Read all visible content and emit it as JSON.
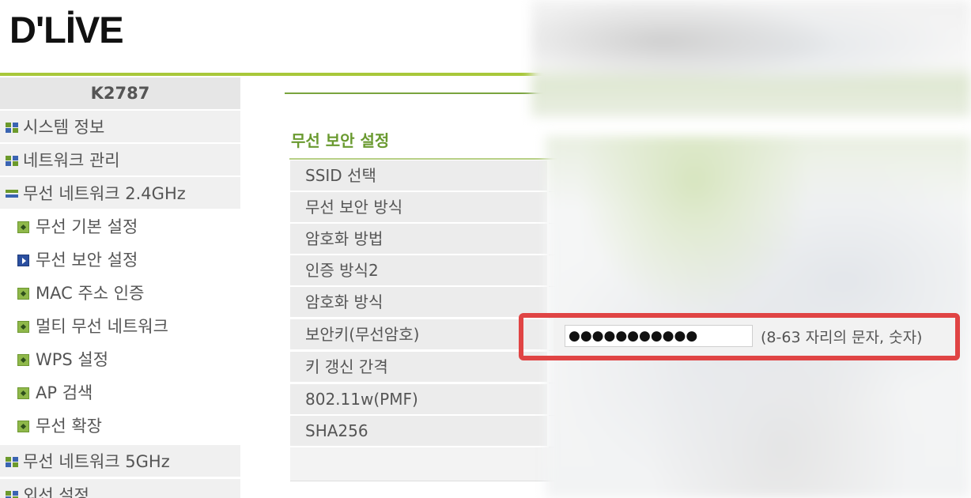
{
  "logo": {
    "text": "D'LİVE"
  },
  "sidebar": {
    "title": "K2787",
    "items": [
      {
        "label": "시스템 정보",
        "icon": "grid-icon",
        "level": "top",
        "active": false
      },
      {
        "label": "네트워크 관리",
        "icon": "grid-icon",
        "level": "top",
        "active": false
      },
      {
        "label": "무선 네트워크 2.4GHz",
        "icon": "minus-icon",
        "level": "top",
        "active": false
      },
      {
        "label": "무선 기본 설정",
        "icon": "bullet-icon",
        "level": "sub",
        "active": false
      },
      {
        "label": "무선 보안 설정",
        "icon": "arrow-bullet-icon",
        "level": "sub",
        "active": true
      },
      {
        "label": "MAC 주소 인증",
        "icon": "bullet-icon",
        "level": "sub",
        "active": false
      },
      {
        "label": "멀티 무선 네트워크",
        "icon": "bullet-icon",
        "level": "sub",
        "active": false
      },
      {
        "label": "WPS 설정",
        "icon": "bullet-icon",
        "level": "sub",
        "active": false
      },
      {
        "label": "AP 검색",
        "icon": "bullet-icon",
        "level": "sub",
        "active": false
      },
      {
        "label": "무선 확장",
        "icon": "bullet-icon",
        "level": "sub",
        "active": false
      },
      {
        "label": "무선 네트워크 5GHz",
        "icon": "grid-icon",
        "level": "top",
        "active": false
      },
      {
        "label": "외선 설정",
        "icon": "grid-icon",
        "level": "top",
        "active": false
      }
    ]
  },
  "main": {
    "section_title": "무선 보안 설정",
    "rows": [
      {
        "label": "SSID 선택"
      },
      {
        "label": "무선 보안 방식"
      },
      {
        "label": "암호화 방법"
      },
      {
        "label": "인증 방식2"
      },
      {
        "label": "암호화 방식"
      },
      {
        "label": "보안키(무선암호)"
      },
      {
        "label": "키 갱신 간격"
      },
      {
        "label": "802.11w(PMF)"
      },
      {
        "label": "SHA256"
      }
    ],
    "security_key": {
      "masked_value": "●●●●●●●●●●●",
      "hint": "(8-63 자리의 문자, 숫자)"
    }
  },
  "colors": {
    "accent_green": "#a8c83a",
    "title_green": "#6a9a30",
    "highlight_red": "#e04444",
    "label_bg": "#ececec"
  }
}
